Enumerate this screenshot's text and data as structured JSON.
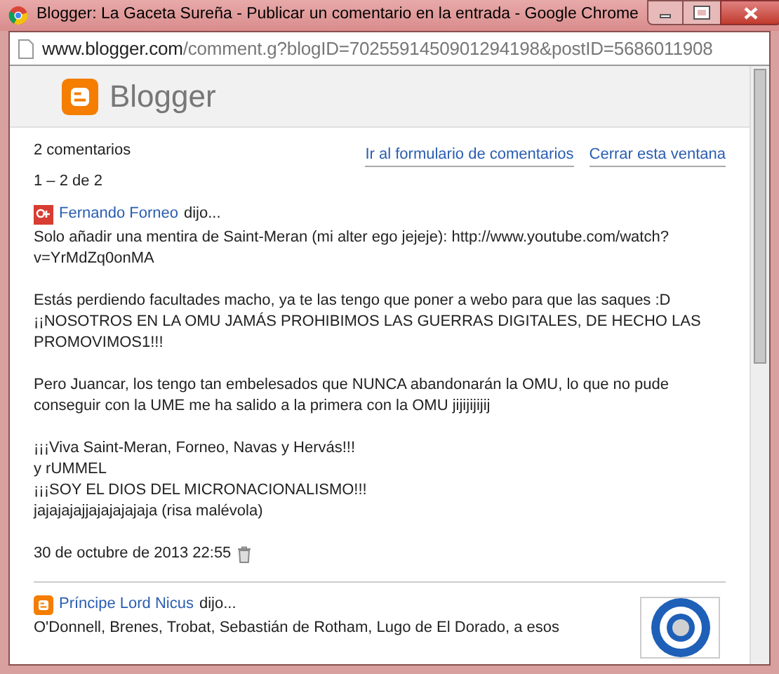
{
  "window": {
    "title": "Blogger: La Gaceta Sureña - Publicar un comentario en la entrada - Google Chrome"
  },
  "address_bar": {
    "host": "www.blogger.com",
    "path": "/comment.g?blogID=7025591450901294198&postID=5686011908"
  },
  "header": {
    "logo_text": "Blogger"
  },
  "summary": {
    "count": "2 comentarios",
    "range": "1 – 2 de 2"
  },
  "links": [
    "Ir al formulario de comentarios",
    "Cerrar esta ventana"
  ],
  "comments": [
    {
      "kind": "gplus",
      "author": "Fernando Forneo",
      "said": "dijo...",
      "avatar": false,
      "paragraphs": [
        [
          "Solo añadir una mentira de Saint-Meran (mi alter ego jejeje): http://www.youtube.com/watch?v=YrMdZq0onMA"
        ],
        [
          "Estás perdiendo facultades macho, ya te las tengo que poner a webo para que las saques :D",
          "¡¡NOSOTROS EN LA OMU JAMÁS PROHIBIMOS LAS GUERRAS DIGITALES, DE HECHO LAS PROMOVIMOS1!!!"
        ],
        [
          "Pero Juancar, los tengo tan embelesados que NUNCA abandonarán la OMU, lo que no pude conseguir con la UME me ha salido a la primera con la OMU jijijijijij"
        ],
        [
          "¡¡¡Viva Saint-Meran, Forneo, Navas y Hervás!!!",
          "y rUMMEL",
          "¡¡¡SOY EL DIOS DEL MICRONACIONALISMO!!!",
          "jajajajajjajajajajaja (risa malévola)"
        ]
      ],
      "timestamp": "30 de octubre de 2013 22:55"
    },
    {
      "kind": "blogger",
      "author": "Príncipe Lord Nicus",
      "said": "dijo...",
      "avatar": true,
      "paragraphs": [
        [
          "O'Donnell, Brenes, Trobat, Sebastián de Rotham, Lugo de El Dorado, a esos"
        ]
      ]
    }
  ]
}
